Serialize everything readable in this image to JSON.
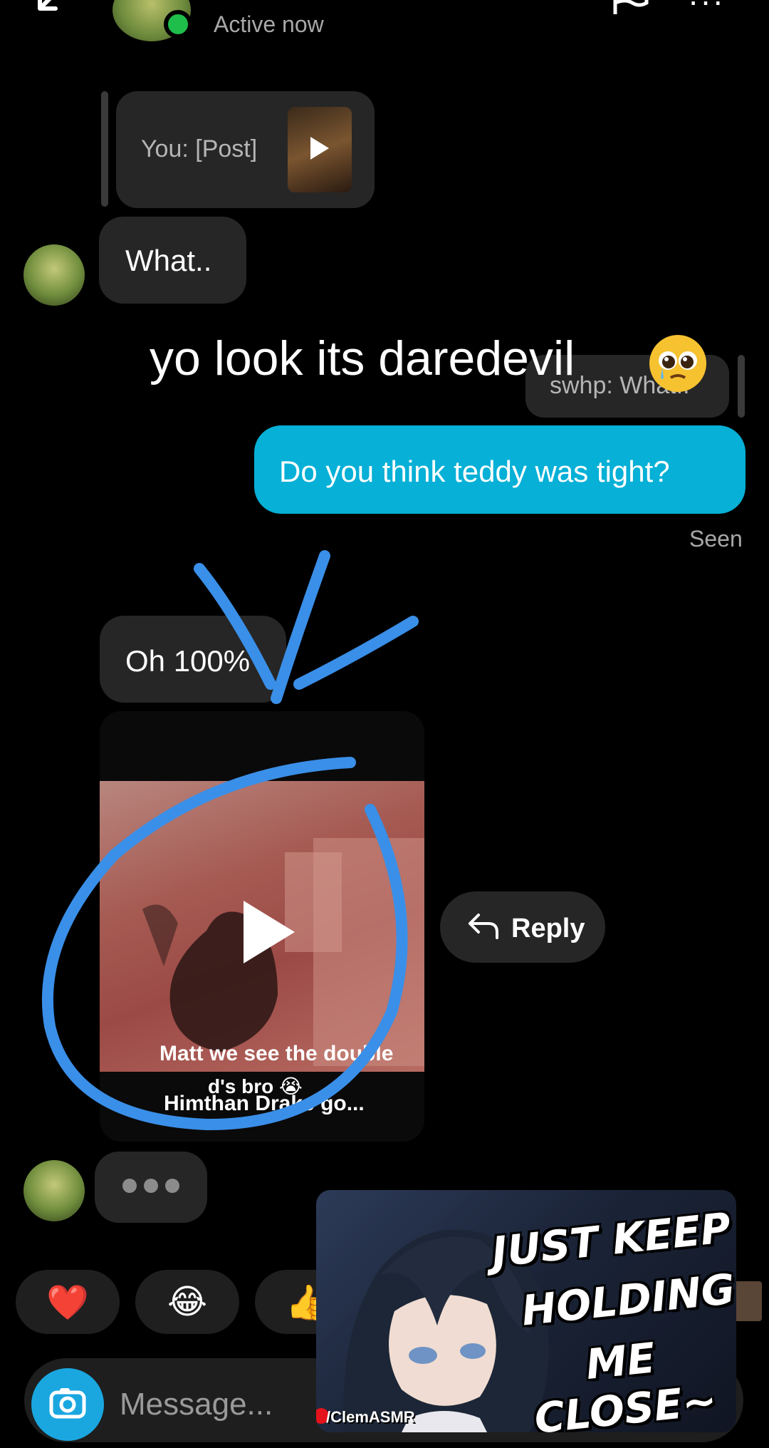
{
  "header": {
    "status": "Active now"
  },
  "conversation": {
    "post_preview": "You: [Post]",
    "msg_what": "What..",
    "overlay_caption": "yo look its daredevil",
    "reply_preview": "swhp: What..",
    "msg_sent": "Do you think teddy was tight?",
    "seen": "Seen",
    "msg_oh": "Oh 100%",
    "video": {
      "caption_line1": "Matt we see the double",
      "caption_line2": "d's bro 😭",
      "author_line": "Himthan Drake go..."
    },
    "reply_button": "Reply"
  },
  "reactions": [
    "❤️",
    "😂",
    "👍"
  ],
  "composer": {
    "placeholder": "Message..."
  },
  "ad": {
    "line1": "JUST KEEP",
    "line2": "HOLDING",
    "line3": "ME CLOSE~",
    "credit": "/ClemASMR"
  },
  "colors": {
    "sent_bubble": "#06b0d6",
    "received_bubble": "#262626",
    "annotation": "#3a8fe8",
    "online": "#1fbe4a"
  }
}
